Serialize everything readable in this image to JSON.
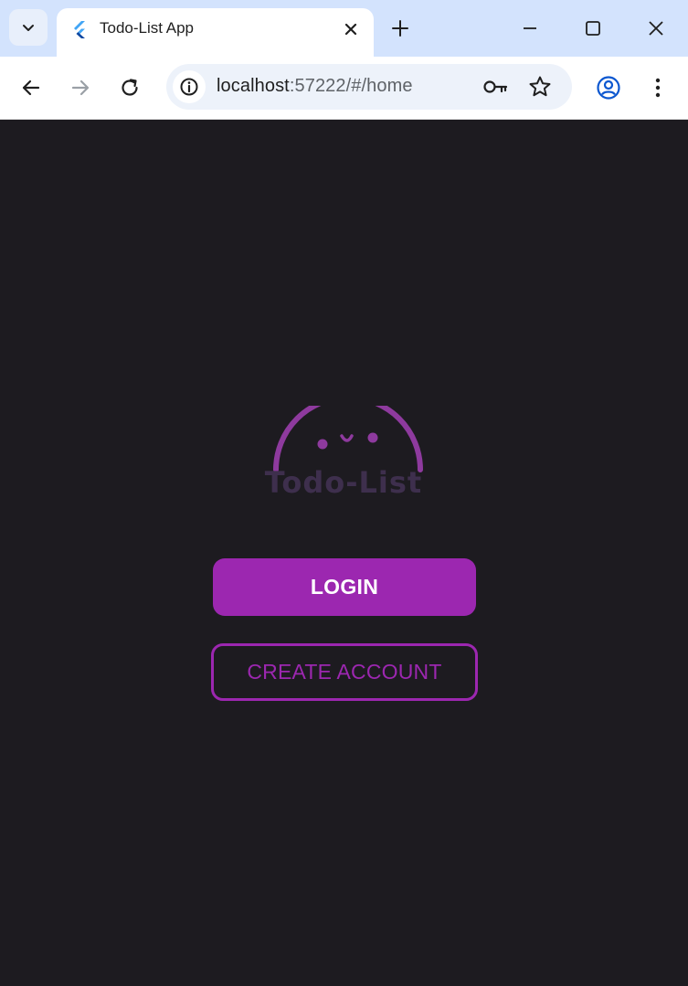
{
  "browser": {
    "tab": {
      "title": "Todo-List App",
      "favicon": "flutter-icon"
    },
    "address_bar": {
      "host": "localhost",
      "path": ":57222/#/home"
    },
    "icons": {
      "tab_search": "chevron-down-icon",
      "tab_close": "close-icon",
      "new_tab": "plus-icon",
      "minimize": "minimize-icon",
      "maximize": "maximize-icon",
      "window_close": "close-icon",
      "back": "back-arrow-icon",
      "forward": "forward-arrow-icon",
      "reload": "reload-icon",
      "site_info": "info-icon",
      "password": "key-icon",
      "bookmark": "star-icon",
      "profile": "profile-icon",
      "menu": "more-vert-icon"
    }
  },
  "app": {
    "logo_text": "Todo-List",
    "login_label": "LOGIN",
    "create_account_label": "CREATE ACCOUNT"
  },
  "colors": {
    "background": "#1d1b20",
    "accent": "#9c27b0",
    "logo_arc": "#8e3a9e",
    "logo_text": "#3e2f4d"
  }
}
